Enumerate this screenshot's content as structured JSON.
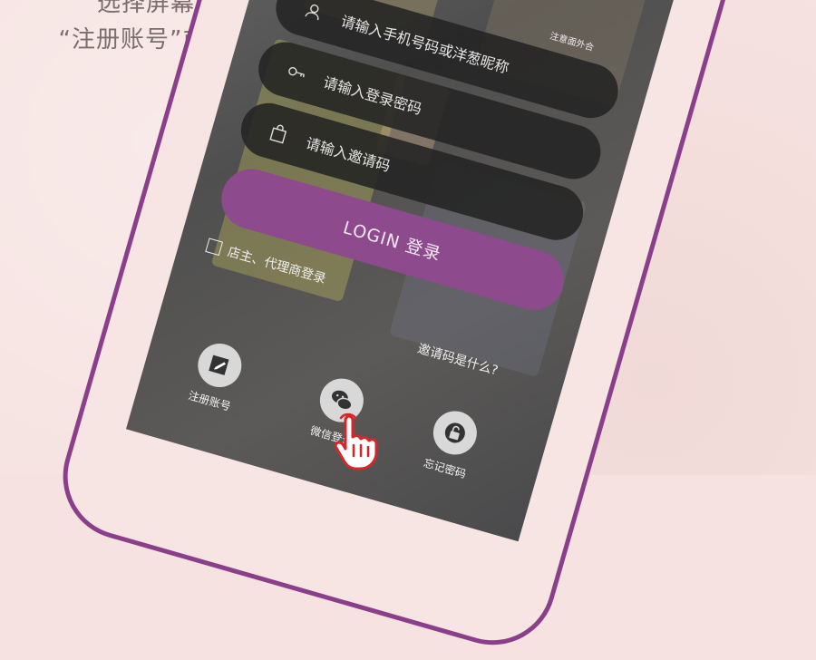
{
  "caption": {
    "line1": "选择屏幕左下角的",
    "line2": "“注册账号”或“微信登录”"
  },
  "login": {
    "phone_placeholder": "请输入手机号码或洋葱昵称",
    "password_placeholder": "请输入登录密码",
    "invite_placeholder": "请输入邀请码",
    "login_button": "LOGIN 登录",
    "shop_agent_checkbox": "店主、代理商登录",
    "invite_help": "邀请码是什么?"
  },
  "actions": {
    "register": "注册账号",
    "wechat": "微信登录",
    "forgot": "忘记密码"
  },
  "top_text": "注意面外合",
  "colors": {
    "accent": "#8d4a8c",
    "frame": "#8b3f8a",
    "background": "#f6e3e1",
    "hand": "#d6262a"
  }
}
